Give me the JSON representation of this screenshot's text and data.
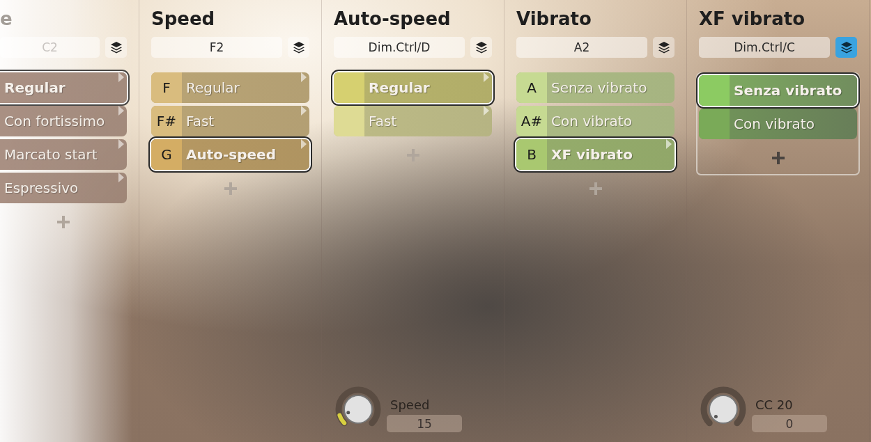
{
  "columns": [
    {
      "title": "e",
      "key": "C2",
      "dimmed": true,
      "layers_active": false,
      "grouped": false,
      "items": [
        {
          "label": "Regular",
          "color": "#b08a76",
          "selected": true,
          "arrow": true
        },
        {
          "label": "Con fortissimo",
          "color": "#b08a76",
          "selected": false,
          "arrow": true
        },
        {
          "label": "Marcato start",
          "color": "#b08a76",
          "selected": false,
          "arrow": true
        },
        {
          "label": "Espressivo",
          "color": "#b08a76",
          "selected": false,
          "arrow": true
        }
      ]
    },
    {
      "title": "Speed",
      "key": "F2",
      "dimmed": false,
      "layers_active": false,
      "grouped": false,
      "items": [
        {
          "key": "F",
          "label": "Regular",
          "color": "#d9bc7e",
          "selected": false,
          "arrow": true
        },
        {
          "key": "F#",
          "label": "Fast",
          "color": "#d9bc7e",
          "selected": false,
          "arrow": true
        },
        {
          "key": "G",
          "label": "Auto-speed",
          "color": "#d4ad64",
          "selected": true,
          "arrow": true
        }
      ]
    },
    {
      "title": "Auto-speed",
      "key": "Dim.Ctrl/D",
      "dimmed": false,
      "layers_active": false,
      "grouped": false,
      "items": [
        {
          "label": "Regular",
          "color": "#d6d070",
          "selected": true,
          "arrow": true
        },
        {
          "label": "Fast",
          "color": "#dedb94",
          "selected": false,
          "arrow": true
        }
      ],
      "knob": {
        "label": "Speed",
        "value": "15",
        "level": 0.1
      }
    },
    {
      "title": "Vibrato",
      "key": "A2",
      "dimmed": false,
      "layers_active": false,
      "grouped": false,
      "items": [
        {
          "key": "A",
          "label": "Senza vibrato",
          "color": "#c6da92",
          "selected": false,
          "arrow": false
        },
        {
          "key": "A#",
          "label": "Con vibrato",
          "color": "#c6da92",
          "selected": false,
          "arrow": false
        },
        {
          "key": "B",
          "label": "XF vibrato",
          "color": "#a9c870",
          "selected": true,
          "arrow": true
        }
      ]
    },
    {
      "title": "XF vibrato",
      "key": "Dim.Ctrl/C",
      "dimmed": false,
      "layers_active": true,
      "grouped": true,
      "items": [
        {
          "label": "Senza vibrato",
          "color": "#8ccb62",
          "selected": true,
          "arrow": false
        },
        {
          "label": "Con vibrato",
          "color": "#7aaa58",
          "selected": false,
          "arrow": false
        }
      ],
      "knob": {
        "label": "CC 20",
        "value": "0",
        "level": 0
      }
    }
  ]
}
